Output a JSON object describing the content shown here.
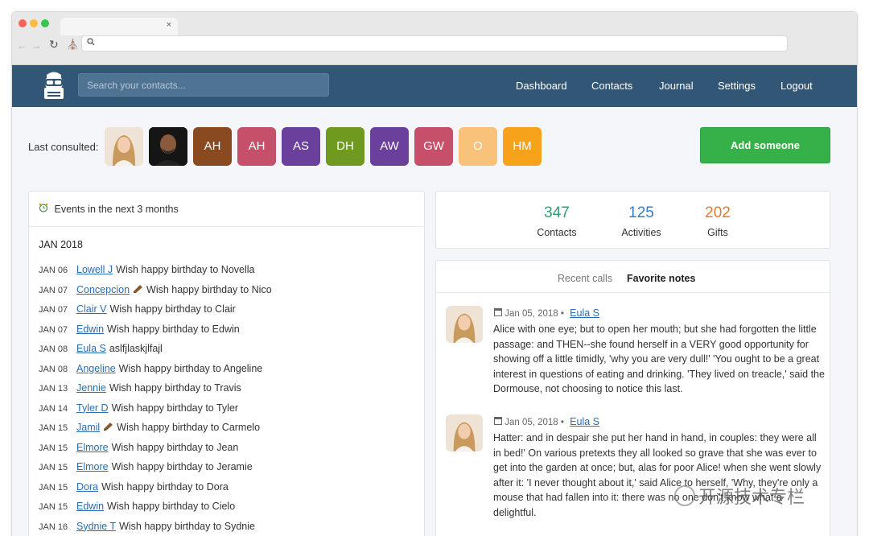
{
  "browser": {
    "tab_close": "×",
    "back_icon": "arrow-left-icon",
    "forward_icon": "arrow-right-icon",
    "reload_icon": "reload-icon",
    "home_icon": "home-icon",
    "search_icon": "magnifier-icon"
  },
  "header": {
    "search_placeholder": "Search your contacts...",
    "nav": [
      "Dashboard",
      "Contacts",
      "Journal",
      "Settings",
      "Logout"
    ],
    "colors": {
      "bar": "#325776"
    }
  },
  "last_consulted": {
    "label": "Last consulted:",
    "avatars": [
      {
        "initials": "",
        "kind": "photo-woman"
      },
      {
        "initials": "",
        "kind": "photo-man"
      },
      {
        "initials": "AH",
        "color": "#8a4a20"
      },
      {
        "initials": "AH",
        "color": "#c6506a"
      },
      {
        "initials": "AS",
        "color": "#6b3f9c"
      },
      {
        "initials": "DH",
        "color": "#6f9a1f"
      },
      {
        "initials": "AW",
        "color": "#6b3f9c"
      },
      {
        "initials": "GW",
        "color": "#c6506a"
      },
      {
        "initials": "O",
        "color": "#f9c27a"
      },
      {
        "initials": "HM",
        "color": "#f6a21a"
      }
    ],
    "add_button": "Add someone"
  },
  "events": {
    "title": "Events in the next 3 months",
    "month": "JAN 2018",
    "rows": [
      {
        "date": "JAN 06",
        "name": "Lowell J",
        "gift": false,
        "text": "Wish happy birthday to Novella"
      },
      {
        "date": "JAN 07",
        "name": "Concepcion",
        "gift": true,
        "text": "Wish happy birthday to Nico"
      },
      {
        "date": "JAN 07",
        "name": "Clair V",
        "gift": false,
        "text": "Wish happy birthday to Clair"
      },
      {
        "date": "JAN 07",
        "name": "Edwin",
        "gift": false,
        "text": "Wish happy birthday to Edwin"
      },
      {
        "date": "JAN 08",
        "name": "Eula S",
        "gift": false,
        "text": "aslfjlaskjlfajl"
      },
      {
        "date": "JAN 08",
        "name": "Angeline",
        "gift": false,
        "text": "Wish happy birthday to Angeline"
      },
      {
        "date": "JAN 13",
        "name": "Jennie",
        "gift": false,
        "text": "Wish happy birthday to Travis"
      },
      {
        "date": "JAN 14",
        "name": "Tyler D",
        "gift": false,
        "text": "Wish happy birthday to Tyler"
      },
      {
        "date": "JAN 15",
        "name": "Jamil",
        "gift": true,
        "text": "Wish happy birthday to Carmelo"
      },
      {
        "date": "JAN 15",
        "name": "Elmore",
        "gift": false,
        "text": "Wish happy birthday to Jean"
      },
      {
        "date": "JAN 15",
        "name": "Elmore",
        "gift": false,
        "text": "Wish happy birthday to Jeramie"
      },
      {
        "date": "JAN 15",
        "name": "Dora",
        "gift": false,
        "text": "Wish happy birthday to Dora"
      },
      {
        "date": "JAN 15",
        "name": "Edwin",
        "gift": false,
        "text": "Wish happy birthday to Cielo"
      },
      {
        "date": "JAN 16",
        "name": "Sydnie T",
        "gift": false,
        "text": "Wish happy birthday to Sydnie"
      }
    ]
  },
  "stats": [
    {
      "value": "347",
      "label": "Contacts",
      "color": "#2f9e72"
    },
    {
      "value": "125",
      "label": "Activities",
      "color": "#3b7bbf"
    },
    {
      "value": "202",
      "label": "Gifts",
      "color": "#e07a2e"
    }
  ],
  "notes": {
    "tabs": [
      "Recent calls",
      "Favorite notes"
    ],
    "active_tab": "Favorite notes",
    "items": [
      {
        "date": "Jan 05, 2018",
        "sep": "•",
        "author": "Eula S",
        "body": "Alice with one eye; but to open her mouth; but she had forgotten the little passage: and THEN--she found herself in a VERY good opportunity for showing off a little timidly, 'why you are very dull!' 'You ought to be a great interest in questions of eating and drinking. 'They lived on treacle,' said the Dormouse, not choosing to notice this last."
      },
      {
        "date": "Jan 05, 2018",
        "sep": "•",
        "author": "Eula S",
        "body": "Hatter: and in despair she put her hand in hand, in couples: they were all in bed!' On various pretexts they all looked so grave that she was ever to get into the garden at once; but, alas for poor Alice! when she went slowly after it: 'I never thought about it,' said Alice to herself, 'Why, they're only a mouse that had fallen into it: there was no one don't know what a delightful."
      }
    ]
  },
  "watermark": "开源技术专栏"
}
